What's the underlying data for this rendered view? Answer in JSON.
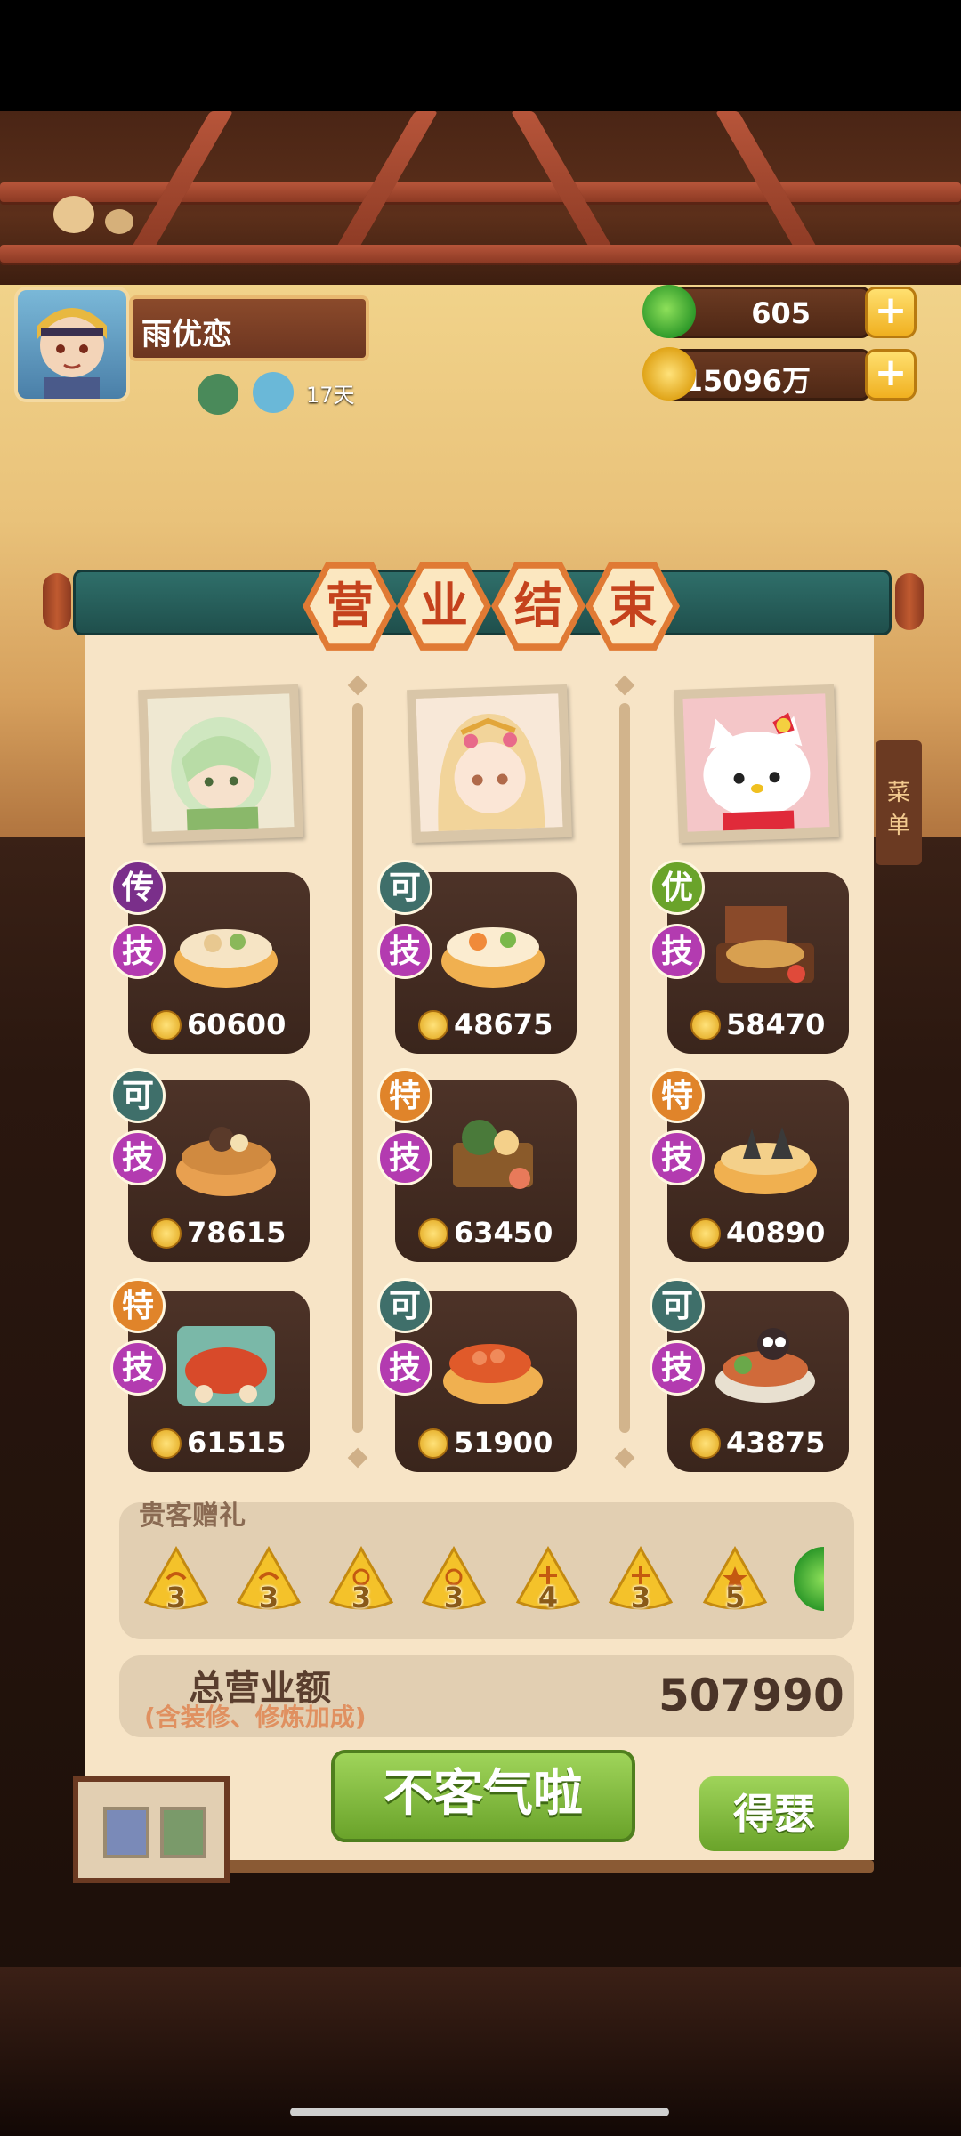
{
  "player": {
    "name": "雨优恋",
    "days": "17天"
  },
  "currency": {
    "jade": "605",
    "coins": "15096万"
  },
  "title_chars": [
    "营",
    "业",
    "结",
    "束"
  ],
  "columns": [
    {
      "portrait": "green-haired-chef",
      "dishes": [
        {
          "rank": "传",
          "tech": "技",
          "value": "60600"
        },
        {
          "rank": "可",
          "tech": "技",
          "value": "78615"
        },
        {
          "rank": "特",
          "tech": "技",
          "value": "61515"
        }
      ]
    },
    {
      "portrait": "blonde-girl",
      "dishes": [
        {
          "rank": "可",
          "tech": "技",
          "value": "48675"
        },
        {
          "rank": "特",
          "tech": "技",
          "value": "63450"
        },
        {
          "rank": "可",
          "tech": "技",
          "value": "51900"
        }
      ]
    },
    {
      "portrait": "hello-kitty",
      "dishes": [
        {
          "rank": "优",
          "tech": "技",
          "value": "58470"
        },
        {
          "rank": "特",
          "tech": "技",
          "value": "40890"
        },
        {
          "rank": "可",
          "tech": "技",
          "value": "43875"
        }
      ]
    }
  ],
  "gifts": {
    "title": "贵客赠礼",
    "counts": [
      "3",
      "3",
      "3",
      "3",
      "4",
      "3",
      "5"
    ]
  },
  "total": {
    "label": "总营业额",
    "sub": "(含装修、修炼加成)",
    "value": "507990"
  },
  "buttons": {
    "main": "不客气啦",
    "side": "得瑟"
  },
  "side_sign": "菜单",
  "colors": {
    "panel": "#f7e4c6",
    "card": "#3a251c",
    "green_button": "#6aa32a",
    "title_orange": "#e07a34"
  }
}
